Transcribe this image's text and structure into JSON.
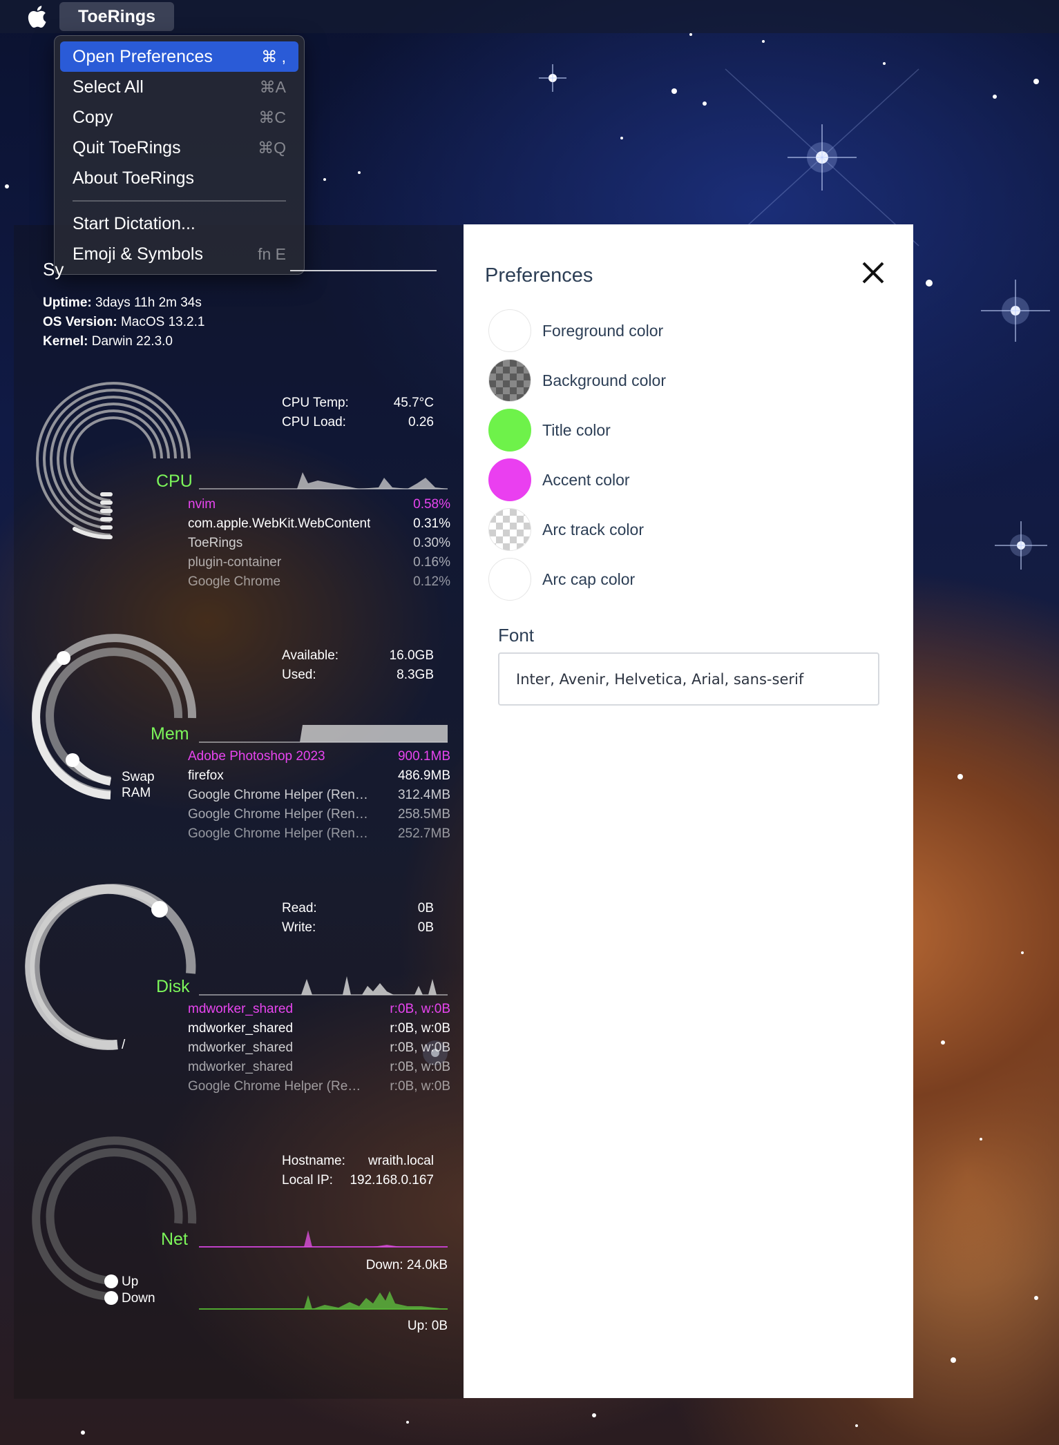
{
  "colors": {
    "title": "#7cf55a",
    "accent": "#e845f0",
    "menu_highlight": "#2a5bd7"
  },
  "menubar": {
    "app_name": "ToeRings",
    "apple_icon": "apple-logo-icon"
  },
  "menu": {
    "items": [
      {
        "label": "Open Preferences",
        "shortcut": "⌘ ,"
      },
      {
        "label": "Select All",
        "shortcut": "⌘A"
      },
      {
        "label": "Copy",
        "shortcut": "⌘C"
      },
      {
        "label": "Quit ToeRings",
        "shortcut": "⌘Q"
      },
      {
        "label": "About ToeRings",
        "shortcut": ""
      },
      {
        "label": "Start Dictation...",
        "shortcut": ""
      },
      {
        "label": "Emoji & Symbols",
        "shortcut": "fn E"
      }
    ]
  },
  "system": {
    "title": "Sy",
    "uptime_label": "Uptime:",
    "uptime": "3days 11h 2m 34s",
    "os_label": "OS Version:",
    "os": "MacOS 13.2.1",
    "kernel_label": "Kernel:",
    "kernel": "Darwin 22.3.0"
  },
  "cpu": {
    "title": "CPU",
    "temp_label": "CPU Temp:",
    "temp": "45.7°C",
    "load_label": "CPU Load:",
    "load": "0.26",
    "processes": [
      {
        "name": "nvim",
        "value": "0.58%"
      },
      {
        "name": "com.apple.WebKit.WebContent",
        "value": "0.31%"
      },
      {
        "name": "ToeRings",
        "value": "0.30%"
      },
      {
        "name": "plugin-container",
        "value": "0.16%"
      },
      {
        "name": "Google Chrome",
        "value": "0.12%"
      }
    ]
  },
  "mem": {
    "title": "Mem",
    "available_label": "Available:",
    "available": "16.0GB",
    "used_label": "Used:",
    "used": "8.3GB",
    "swap_label": "Swap",
    "ram_label": "RAM",
    "processes": [
      {
        "name": "Adobe Photoshop 2023",
        "value": "900.1MB"
      },
      {
        "name": "firefox",
        "value": "486.9MB"
      },
      {
        "name": "Google Chrome Helper (Ren…",
        "value": "312.4MB"
      },
      {
        "name": "Google Chrome Helper (Ren…",
        "value": "258.5MB"
      },
      {
        "name": "Google Chrome Helper (Ren…",
        "value": "252.7MB"
      }
    ]
  },
  "disk": {
    "title": "Disk",
    "read_label": "Read:",
    "read": "0B",
    "write_label": "Write:",
    "write": "0B",
    "mount_label": "/",
    "processes": [
      {
        "name": "mdworker_shared",
        "value": "r:0B, w:0B"
      },
      {
        "name": "mdworker_shared",
        "value": "r:0B, w:0B"
      },
      {
        "name": "mdworker_shared",
        "value": "r:0B, w:0B"
      },
      {
        "name": "mdworker_shared",
        "value": "r:0B, w:0B"
      },
      {
        "name": "Google Chrome Helper (Re…",
        "value": "r:0B, w:0B"
      }
    ]
  },
  "net": {
    "title": "Net",
    "hostname_label": "Hostname:",
    "hostname": "wraith.local",
    "ip_label": "Local IP:",
    "ip": "192.168.0.167",
    "down": "Down: 24.0kB",
    "up": "Up: 0B",
    "legend_up": "Up",
    "legend_down": "Down"
  },
  "preferences": {
    "title": "Preferences",
    "close_icon": "close-icon",
    "color_options": [
      {
        "label": "Foreground color",
        "swatch": "#ffffff"
      },
      {
        "label": "Background color",
        "swatch": "checker-dark"
      },
      {
        "label": "Title color",
        "swatch": "#6ef24a"
      },
      {
        "label": "Accent color",
        "swatch": "#ea3ff0"
      },
      {
        "label": "Arc track color",
        "swatch": "checker-light"
      },
      {
        "label": "Arc cap color",
        "swatch": "#ffffff"
      }
    ],
    "font_label": "Font",
    "font_value": "Inter, Avenir, Helvetica, Arial, sans-serif"
  }
}
